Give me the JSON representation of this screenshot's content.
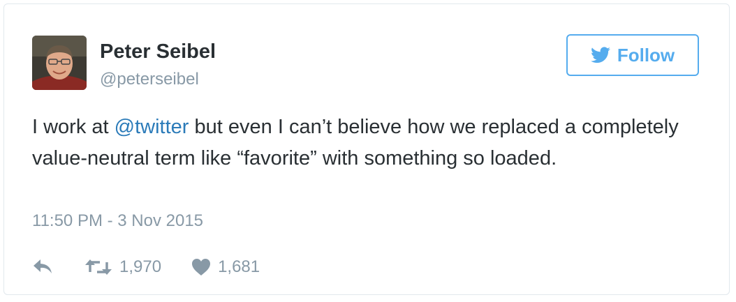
{
  "tweet": {
    "author": {
      "name": "Peter Seibel",
      "handle": "@peterseibel"
    },
    "follow_button": {
      "icon": "twitter-bird-icon",
      "label": "Follow"
    },
    "text": {
      "before_mention": "I work at ",
      "mention": "@twitter",
      "after_mention": " but even I can’t believe how we replaced a completely value-neutral term like “favorite” with something so loaded."
    },
    "timestamp": "11:50 PM - 3 Nov 2015",
    "actions": {
      "reply": {
        "icon": "reply-icon"
      },
      "retweet": {
        "icon": "retweet-icon",
        "count": "1,970"
      },
      "like": {
        "icon": "heart-icon",
        "count": "1,681"
      }
    }
  },
  "colors": {
    "accent": "#55acee",
    "mention": "#2b7bb9",
    "text": "#292f33",
    "muted": "#8899a6",
    "border": "#e1e8ed"
  }
}
